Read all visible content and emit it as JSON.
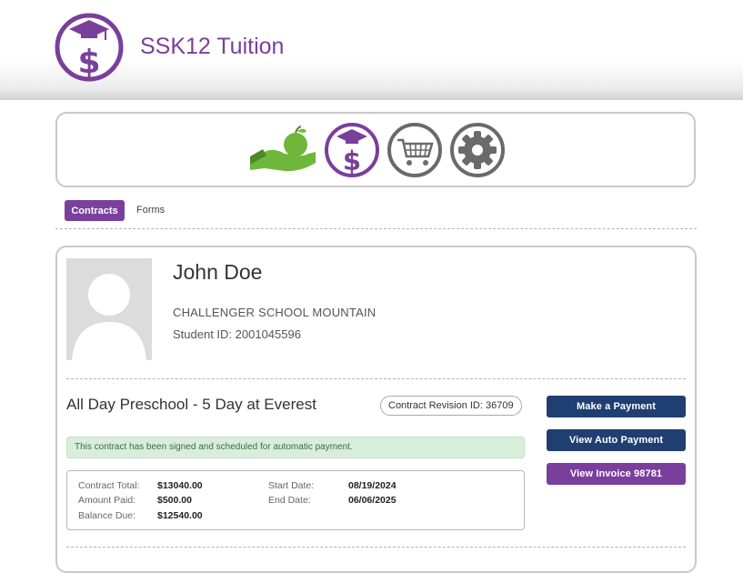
{
  "header": {
    "app_title": "SSK12 Tuition"
  },
  "nav_icons": [
    "hand-apple-icon",
    "tuition-dollar-icon",
    "shopping-cart-icon",
    "gear-icon"
  ],
  "tabs": {
    "active": "Contracts",
    "forms": "Forms"
  },
  "student": {
    "name": "John Doe",
    "school": "CHALLENGER SCHOOL MOUNTAIN",
    "student_id": "Student ID: 2001045596"
  },
  "contract": {
    "title": "All Day Preschool - 5 Day at Everest",
    "revision": "Contract Revision ID: 36709",
    "alert": "This contract has been signed and scheduled for automatic payment.",
    "labels": {
      "total": "Contract Total:",
      "paid": "Amount Paid:",
      "balance": "Balance Due:",
      "start": "Start Date:",
      "end": "End Date:"
    },
    "values": {
      "total": "$13040.00",
      "paid": "$500.00",
      "balance": "$12540.00",
      "start": "08/19/2024",
      "end": "06/06/2025"
    }
  },
  "buttons": {
    "make_payment": "Make a Payment",
    "view_auto_payment": "View Auto Payment",
    "view_invoice": "View Invoice 98781"
  },
  "colors": {
    "brand_purple": "#7a3f9a",
    "button_blue": "#1f3e72",
    "apple_green": "#6fb73a",
    "alert_green_bg": "#d8eedb"
  }
}
